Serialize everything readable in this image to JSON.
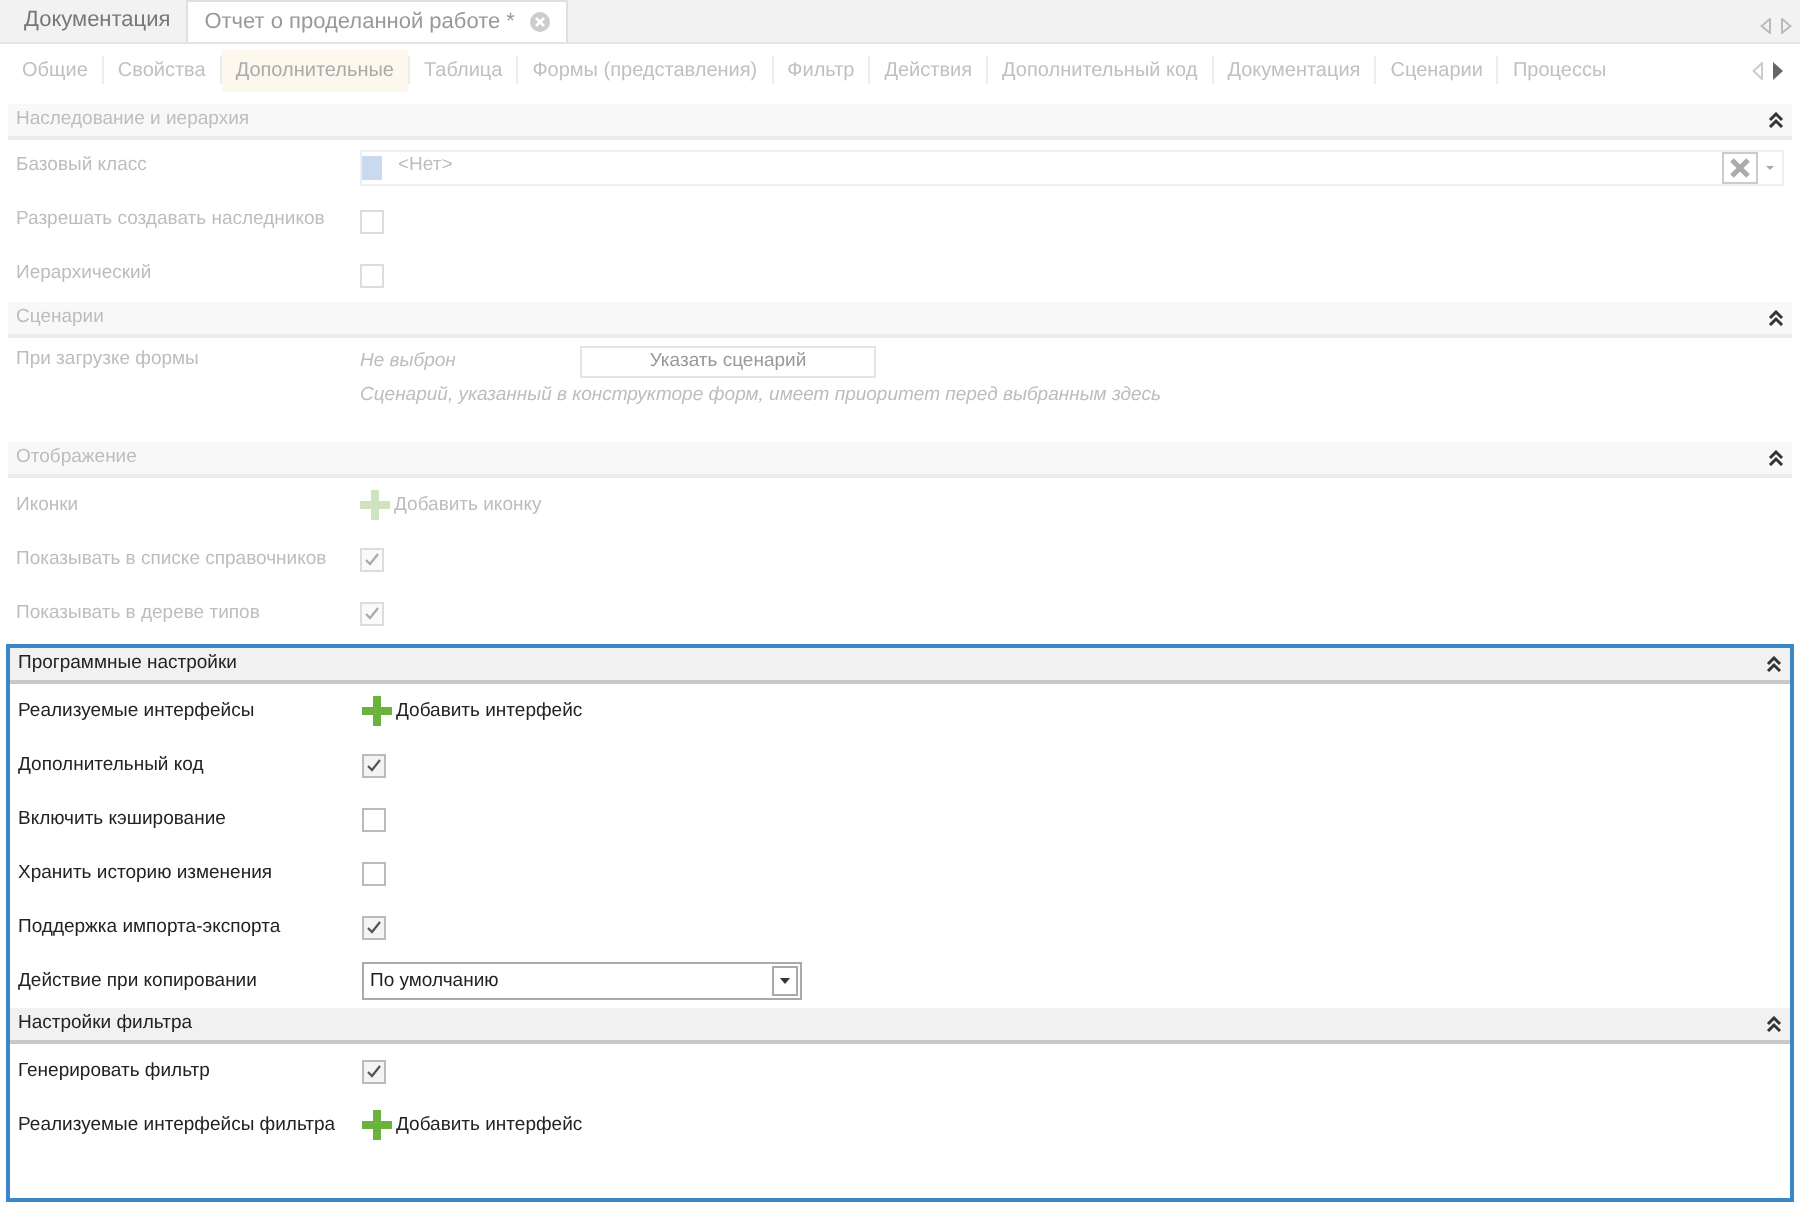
{
  "document_tabs": [
    {
      "label": "Документация",
      "selected": false,
      "closable": false
    },
    {
      "label": "Отчет о проделанной работе *",
      "selected": true,
      "closable": true
    }
  ],
  "tabs": [
    {
      "label": "Общие",
      "selected": false
    },
    {
      "label": "Свойства",
      "selected": false
    },
    {
      "label": "Дополнительные",
      "selected": true
    },
    {
      "label": "Таблица",
      "selected": false
    },
    {
      "label": "Формы (представления)",
      "selected": false
    },
    {
      "label": "Фильтр",
      "selected": false
    },
    {
      "label": "Действия",
      "selected": false
    },
    {
      "label": "Дополнительный код",
      "selected": false
    },
    {
      "label": "Документация",
      "selected": false
    },
    {
      "label": "Сценарии",
      "selected": false
    },
    {
      "label": "Процессы",
      "selected": false
    }
  ],
  "sections": [
    {
      "title": "Наследование и иерархия",
      "dimmed": true,
      "rows": [
        {
          "kind": "lookup",
          "label": "Базовый класс",
          "value": "<Нет>"
        },
        {
          "kind": "checkbox",
          "label": "Разрешать создавать наследников",
          "checked": false
        },
        {
          "kind": "checkbox",
          "label": "Иерархический",
          "checked": false
        }
      ]
    },
    {
      "title": "Сценарии",
      "dimmed": true,
      "rows": [
        {
          "kind": "scenario",
          "label": "При загрузке формы",
          "value": "Не выброн",
          "button": "Указать сценарий",
          "hint": "Сценарий, указанный в конструкторе форм, имеет приоритет перед выбранным здесь"
        }
      ]
    },
    {
      "title": "Отображение",
      "dimmed": true,
      "rows": [
        {
          "kind": "add",
          "label": "Иконки",
          "action": "Добавить иконку"
        },
        {
          "kind": "checkbox",
          "label": "Показывать в списке справочников",
          "checked": true
        },
        {
          "kind": "checkbox",
          "label": "Показывать в дереве типов",
          "checked": true
        }
      ]
    }
  ],
  "focused_panel": {
    "sections": [
      {
        "title": "Программные настройки",
        "dimmed": false,
        "rows": [
          {
            "kind": "add",
            "label": "Реализуемые интерфейсы",
            "action": "Добавить интерфейс"
          },
          {
            "kind": "checkbox",
            "label": "Дополнительный код",
            "checked": true
          },
          {
            "kind": "checkbox",
            "label": "Включить кэширование",
            "checked": false
          },
          {
            "kind": "checkbox",
            "label": "Хранить историю изменения",
            "checked": false
          },
          {
            "kind": "checkbox",
            "label": "Поддержка импорта-экспорта",
            "checked": true
          },
          {
            "kind": "select",
            "label": "Действие при копировании",
            "value": "По умолчанию"
          }
        ]
      },
      {
        "title": "Настройки фильтра",
        "dimmed": false,
        "rows": [
          {
            "kind": "checkbox",
            "label": "Генерировать фильтр",
            "checked": true
          },
          {
            "kind": "add",
            "label": "Реализуемые интерфейсы фильтра",
            "action": "Добавить интерфейс"
          }
        ]
      }
    ]
  }
}
